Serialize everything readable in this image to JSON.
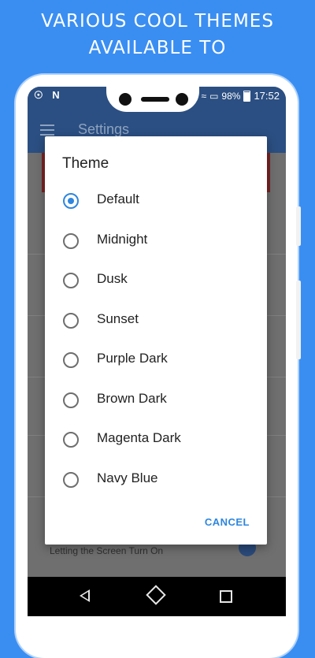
{
  "promo": {
    "line1": "VARIOUS COOL THEMES",
    "line2": "AVAILABLE TO"
  },
  "status_bar": {
    "left_icons": [
      "lightbulb-icon",
      "n-icon"
    ],
    "battery_percent": "98%",
    "time": "17:52"
  },
  "app_bar": {
    "title": "Settings"
  },
  "background": {
    "setting_text": "Letting the Screen Turn On"
  },
  "dialog": {
    "title": "Theme",
    "options": [
      {
        "label": "Default",
        "selected": true
      },
      {
        "label": "Midnight",
        "selected": false
      },
      {
        "label": "Dusk",
        "selected": false
      },
      {
        "label": "Sunset",
        "selected": false
      },
      {
        "label": "Purple Dark",
        "selected": false
      },
      {
        "label": "Brown Dark",
        "selected": false
      },
      {
        "label": "Magenta Dark",
        "selected": false
      },
      {
        "label": "Navy Blue",
        "selected": false
      }
    ],
    "cancel_label": "CANCEL"
  },
  "colors": {
    "promo_background": "#3a8ef2",
    "app_bar": "#2b4f82",
    "accent": "#2e86de",
    "scrim": "#707070"
  }
}
